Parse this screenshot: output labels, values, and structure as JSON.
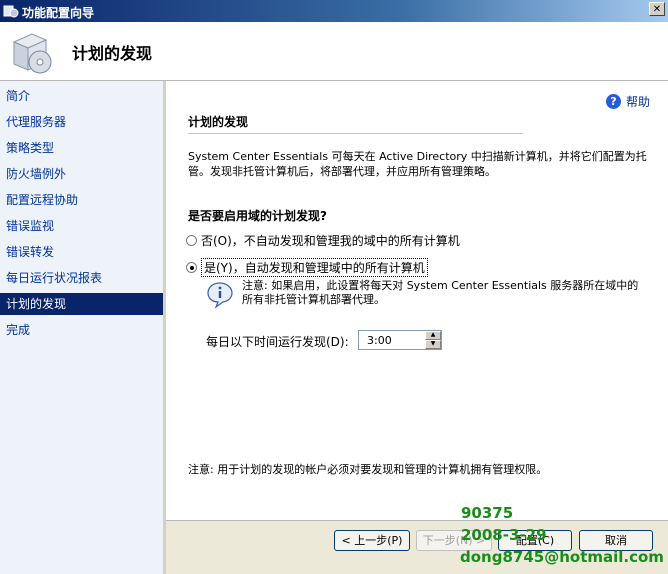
{
  "window": {
    "title": "功能配置向导"
  },
  "header": {
    "title": "计划的发现"
  },
  "sidebar": {
    "items": [
      {
        "label": "简介"
      },
      {
        "label": "代理服务器"
      },
      {
        "label": "策略类型"
      },
      {
        "label": "防火墙例外"
      },
      {
        "label": "配置远程协助"
      },
      {
        "label": "错误监视"
      },
      {
        "label": "错误转发"
      },
      {
        "label": "每日运行状况报表"
      },
      {
        "label": "计划的发现"
      },
      {
        "label": "完成"
      }
    ],
    "active_index": 8
  },
  "main": {
    "help_label": "帮助",
    "section_title": "计划的发现",
    "description": "System Center Essentials 可每天在 Active Directory 中扫描新计算机，并将它们配置为托管。发现非托管计算机后，将部署代理，并应用所有管理策略。",
    "question": "是否要启用域的计划发现?",
    "option_no": "否(O)，不自动发现和管理我的域中的所有计算机",
    "option_yes": "是(Y)，自动发现和管理域中的所有计算机",
    "selected_option": "yes",
    "note": "注意: 如果启用，此设置将每天对 System Center Essentials 服务器所在域中的所有非托管计算机部署代理。",
    "time_label": "每日以下时间运行发现(D):",
    "time_value": "3:00",
    "footnote": "注意: 用于计划的发现的帐户必须对要发现和管理的计算机拥有管理权限。"
  },
  "buttons": {
    "back": "< 上一步(P)",
    "next": "下一步(N) >",
    "configure": "配置(C)",
    "cancel": "取消"
  },
  "watermark": {
    "line1": "90375",
    "line2": "2008-3-29",
    "line3": "dong8745@hotmail.com"
  },
  "colors": {
    "title_bar": "#0a246a",
    "nav_link": "#003399",
    "nav_active_bg": "#0a246a",
    "watermark": "#1a8c1a"
  }
}
